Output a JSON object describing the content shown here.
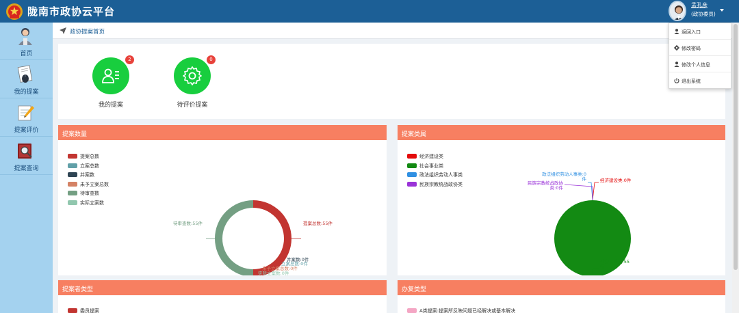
{
  "header": {
    "title": "陇南市政协云平台",
    "user_name": "孟孔彦",
    "user_role": "(政协委员)"
  },
  "sidebar": {
    "items": [
      {
        "label": "首页"
      },
      {
        "label": "我的提案"
      },
      {
        "label": "提案评价"
      },
      {
        "label": "提案查询"
      }
    ]
  },
  "breadcrumb": {
    "text": "政协提案首页"
  },
  "quick_links": [
    {
      "label": "我的提案",
      "badge": "2"
    },
    {
      "label": "待评价提案",
      "badge": "0"
    }
  ],
  "user_menu": {
    "items": [
      {
        "label": "返回入口",
        "icon": "user-icon"
      },
      {
        "label": "修改密码",
        "icon": "gear-icon"
      },
      {
        "label": "修改个人信息",
        "icon": "user-icon"
      },
      {
        "label": "退出系统",
        "icon": "power-icon"
      }
    ]
  },
  "cards": {
    "count": {
      "title": "提案数量"
    },
    "category": {
      "title": "提案类属"
    },
    "proposer": {
      "title": "提案者类型"
    },
    "handling": {
      "title": "办复类型"
    }
  },
  "chart_data": [
    {
      "type": "pie",
      "variant": "donut",
      "title": "提案数量",
      "legend_placement": "top-left",
      "legend": [
        "提案总数",
        "立案总数",
        "并案数",
        "未予立案总数",
        "待审查数",
        "实际立案数"
      ],
      "colors": [
        "#c23531",
        "#61a0a8",
        "#2f4554",
        "#d48265",
        "#749f83",
        "#91c7ae"
      ],
      "values": [
        55,
        0,
        0,
        0,
        55,
        0
      ],
      "labels": [
        "提案总数:55件",
        "立案总数:0件",
        "并案数:0件",
        "未予立案总数:0件",
        "待审查数:55件",
        "实际立案数:0件"
      ]
    },
    {
      "type": "pie",
      "title": "提案类属",
      "legend_placement": "top-left",
      "legend": [
        "经济建设类",
        "社会事业类",
        "政法组织劳动人事类",
        "民族宗教统战政协类"
      ],
      "colors": [
        "#e30b0b",
        "#138a13",
        "#3090e2",
        "#9a33d8"
      ],
      "values": [
        0,
        55,
        0,
        0
      ],
      "labels": [
        "经济建设类:0件",
        "社会事业类:55件",
        "政法组织劳动人事类:0件",
        "民族宗教统战政协类:0件"
      ]
    },
    {
      "type": "pie",
      "title": "提案者类型",
      "legend": [
        "委员提案"
      ],
      "colors": [
        "#c23531"
      ]
    },
    {
      "type": "pie",
      "title": "办复类型",
      "legend": [
        "A类提案:提案所反映问题已经解决或基本解决"
      ],
      "colors": [
        "#f4a6c4"
      ]
    }
  ]
}
